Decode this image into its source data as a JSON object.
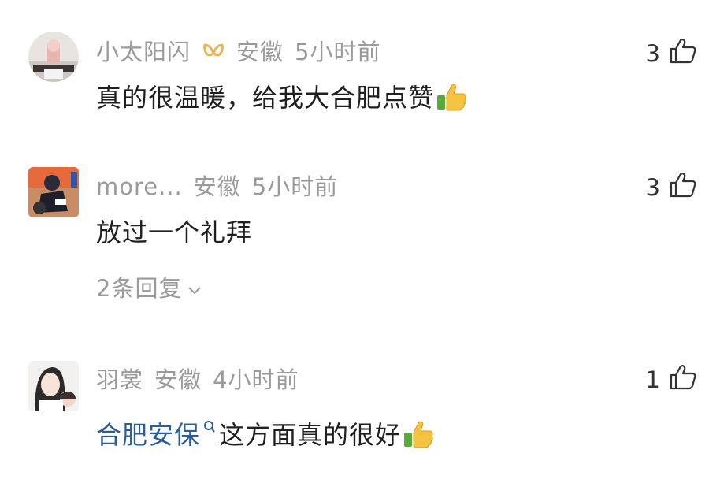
{
  "comments": [
    {
      "username": "小太阳闪",
      "location": "安徽",
      "time": "5小时前",
      "text": "真的很温暖，给我大合肥点赞",
      "likes": "3",
      "badge_icon": "gold-ribbon-icon",
      "emoji_icon": "thumbs-up-emoji-icon"
    },
    {
      "username": "more...",
      "location": "安徽",
      "time": "5小时前",
      "text": "放过一个礼拜",
      "likes": "3",
      "replies_label": "2条回复"
    },
    {
      "username": "羽裳",
      "location": "安徽",
      "time": "4小时前",
      "text_link": "合肥安保",
      "text_rest": "这方面真的很好",
      "likes": "1",
      "emoji_icon": "thumbs-up-emoji-icon"
    }
  ],
  "colors": {
    "meta_gray": "#9a9a9a",
    "link_blue": "#2a5d9c",
    "text_dark": "#1f1f1f"
  }
}
